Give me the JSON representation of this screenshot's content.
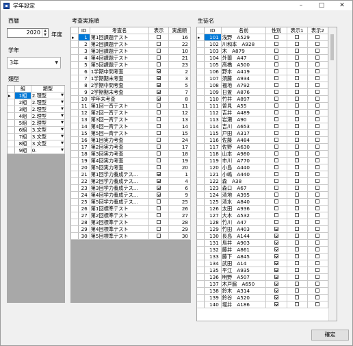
{
  "window": {
    "title": "学年設定",
    "minimize": "–",
    "maximize": "□",
    "close": "✕"
  },
  "left": {
    "year_label": "西暦",
    "year_value": "2020",
    "year_unit": "年度",
    "spin_up": "▲",
    "spin_down": "▼",
    "grade_label": "学年",
    "grade_value": "3年",
    "type_label": "類型",
    "type_headers": [
      "組",
      "類型"
    ],
    "type_rows": [
      [
        "1組",
        "2.理型"
      ],
      [
        "2組",
        "2.理型"
      ],
      [
        "3組",
        "2.理型"
      ],
      [
        "4組",
        "2.理型"
      ],
      [
        "5組",
        "2.理型"
      ],
      [
        "6組",
        "3.文型"
      ],
      [
        "7組",
        "3.文型"
      ],
      [
        "8組",
        "3.文型"
      ],
      [
        "9組",
        "0."
      ]
    ]
  },
  "exams": {
    "label": "考査実施順",
    "headers": [
      "ID",
      "考査名",
      "表示",
      "実施順"
    ],
    "rows": [
      [
        "1",
        "第1回課題テスト",
        false,
        "16"
      ],
      [
        "2",
        "第2回課題テスト",
        false,
        "22"
      ],
      [
        "3",
        "第3回課題テスト",
        false,
        "10"
      ],
      [
        "4",
        "第4回課題テスト",
        false,
        "21"
      ],
      [
        "5",
        "第5回課題テスト",
        false,
        "23"
      ],
      [
        "6",
        "1学期中間考査",
        true,
        "2"
      ],
      [
        "7",
        "1学期期末考査",
        true,
        "3"
      ],
      [
        "8",
        "2学期中間考査",
        true,
        "5"
      ],
      [
        "9",
        "2学期期末考査",
        true,
        "7"
      ],
      [
        "10",
        "学年末考査",
        true,
        "8"
      ],
      [
        "11",
        "第1回一斉テスト",
        false,
        "11"
      ],
      [
        "12",
        "第2回一斉テスト",
        false,
        "12"
      ],
      [
        "13",
        "第3回一斉テスト",
        false,
        "13"
      ],
      [
        "14",
        "第4回一斉テスト",
        false,
        "14"
      ],
      [
        "15",
        "第5回一斉テスト",
        false,
        "15"
      ],
      [
        "16",
        "第1回実力考査",
        false,
        "24"
      ],
      [
        "17",
        "第2回実力考査",
        false,
        "17"
      ],
      [
        "18",
        "第3回実力考査",
        false,
        "18"
      ],
      [
        "19",
        "第4回実力考査",
        false,
        "19"
      ],
      [
        "20",
        "第5回実力考査",
        false,
        "20"
      ],
      [
        "21",
        "第1回学力養成テス…",
        true,
        "1"
      ],
      [
        "22",
        "第2回学力養成テス…",
        true,
        "4"
      ],
      [
        "23",
        "第3回学力養成テス…",
        true,
        "6"
      ],
      [
        "24",
        "第4回学力養成テス…",
        true,
        "9"
      ],
      [
        "25",
        "第5回学力養成テス…",
        false,
        "25"
      ],
      [
        "26",
        "第1回標準テスト",
        false,
        "26"
      ],
      [
        "27",
        "第2回標準テスト",
        false,
        "27"
      ],
      [
        "28",
        "第3回標準テスト",
        false,
        "28"
      ],
      [
        "29",
        "第4回標準テスト",
        false,
        "29"
      ],
      [
        "30",
        "第5回標準テスト",
        false,
        "30"
      ]
    ]
  },
  "students": {
    "label": "生徒名",
    "headers": [
      "ID",
      "名前",
      "性別",
      "表示1",
      "表示2"
    ],
    "rows": [
      [
        "101",
        "浅野　A529",
        false,
        false,
        false
      ],
      [
        "102",
        "川和本　A928",
        false,
        false,
        false
      ],
      [
        "103",
        "木　A879",
        false,
        false,
        false
      ],
      [
        "104",
        "外薗　A47",
        false,
        false,
        false
      ],
      [
        "105",
        "高橋　A500",
        false,
        false,
        false
      ],
      [
        "106",
        "野本　A419",
        false,
        false,
        false
      ],
      [
        "107",
        "須藤　A934",
        false,
        false,
        false
      ],
      [
        "108",
        "福地　A792",
        false,
        false,
        false
      ],
      [
        "109",
        "日置　A876",
        false,
        false,
        false
      ],
      [
        "110",
        "竹井　A897",
        false,
        false,
        false
      ],
      [
        "111",
        "曽見　A55",
        false,
        false,
        false
      ],
      [
        "112",
        "吉井　A489",
        false,
        false,
        false
      ],
      [
        "113",
        "岩瀬　A90",
        false,
        false,
        false
      ],
      [
        "114",
        "吉川　A653",
        false,
        false,
        false
      ],
      [
        "115",
        "戸田　A317",
        false,
        false,
        false
      ],
      [
        "116",
        "佐藤　A484",
        false,
        false,
        false
      ],
      [
        "117",
        "佐野　A630",
        false,
        false,
        false
      ],
      [
        "118",
        "山本　A980",
        false,
        false,
        false
      ],
      [
        "119",
        "市川　A770",
        false,
        false,
        false
      ],
      [
        "120",
        "小島　A440",
        false,
        false,
        false
      ],
      [
        "121",
        "小嶋　A440",
        false,
        false,
        false
      ],
      [
        "122",
        "森　A38",
        false,
        false,
        false
      ],
      [
        "123",
        "森口　A67",
        false,
        false,
        false
      ],
      [
        "124",
        "清地　A395",
        false,
        false,
        false
      ],
      [
        "125",
        "清水　A840",
        false,
        false,
        false
      ],
      [
        "126",
        "太田　A936",
        false,
        false,
        false
      ],
      [
        "127",
        "大木　A532",
        false,
        false,
        false
      ],
      [
        "128",
        "竹川　A47",
        false,
        false,
        false
      ],
      [
        "129",
        "竹田　A403",
        true,
        false,
        false
      ],
      [
        "130",
        "長島　A144",
        true,
        false,
        false
      ],
      [
        "131",
        "鳥井　A903",
        true,
        false,
        false
      ],
      [
        "132",
        "藤井　A861",
        true,
        false,
        false
      ],
      [
        "133",
        "藤下　A845",
        true,
        false,
        false
      ],
      [
        "134",
        "武田　A14",
        true,
        false,
        false
      ],
      [
        "135",
        "平江　A935",
        true,
        false,
        false
      ],
      [
        "136",
        "明野　A507",
        true,
        false,
        false
      ],
      [
        "137",
        "木戸脇　A650",
        true,
        false,
        false
      ],
      [
        "138",
        "鈴木　A314",
        true,
        false,
        false
      ],
      [
        "139",
        "鈴谷　A520",
        true,
        false,
        false
      ],
      [
        "140",
        "堀井　A186",
        true,
        false,
        false
      ]
    ]
  },
  "ok_button": "確定"
}
